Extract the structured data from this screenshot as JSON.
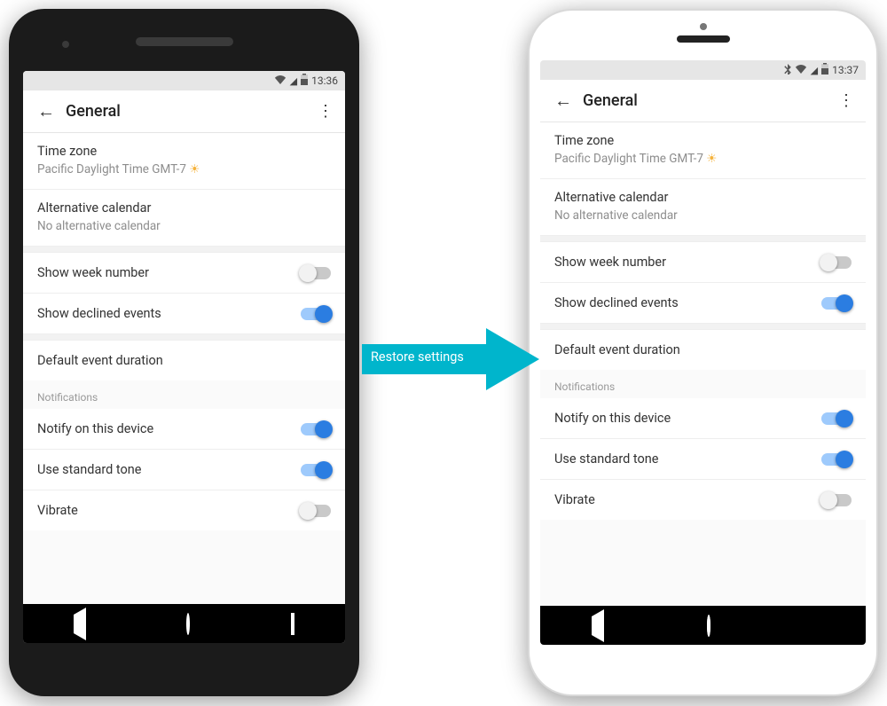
{
  "arrow": {
    "label": "Restore settings",
    "color": "#00b5cc"
  },
  "phones": [
    {
      "status": {
        "time": "13:36",
        "bluetooth": false
      },
      "appbar": {
        "title": "General"
      },
      "settings": {
        "timezone": {
          "title": "Time zone",
          "value": "Pacific Daylight Time  GMT-7",
          "sun": "☀"
        },
        "altcal": {
          "title": "Alternative calendar",
          "value": "No alternative calendar"
        },
        "weeknum": {
          "title": "Show week number",
          "on": false
        },
        "declined": {
          "title": "Show declined events",
          "on": true
        },
        "defdur": {
          "title": "Default event duration"
        },
        "section_notifications": "Notifications",
        "notify": {
          "title": "Notify on this device",
          "on": true
        },
        "tone": {
          "title": "Use standard tone",
          "on": true
        },
        "vibrate": {
          "title": "Vibrate",
          "on": false
        }
      }
    },
    {
      "status": {
        "time": "13:37",
        "bluetooth": true
      },
      "appbar": {
        "title": "General"
      },
      "settings": {
        "timezone": {
          "title": "Time zone",
          "value": "Pacific Daylight Time  GMT-7",
          "sun": "☀"
        },
        "altcal": {
          "title": "Alternative calendar",
          "value": "No alternative calendar"
        },
        "weeknum": {
          "title": "Show week number",
          "on": false
        },
        "declined": {
          "title": "Show declined events",
          "on": true
        },
        "defdur": {
          "title": "Default event duration"
        },
        "section_notifications": "Notifications",
        "notify": {
          "title": "Notify on this device",
          "on": true
        },
        "tone": {
          "title": "Use standard tone",
          "on": true
        },
        "vibrate": {
          "title": "Vibrate",
          "on": false
        }
      }
    }
  ]
}
